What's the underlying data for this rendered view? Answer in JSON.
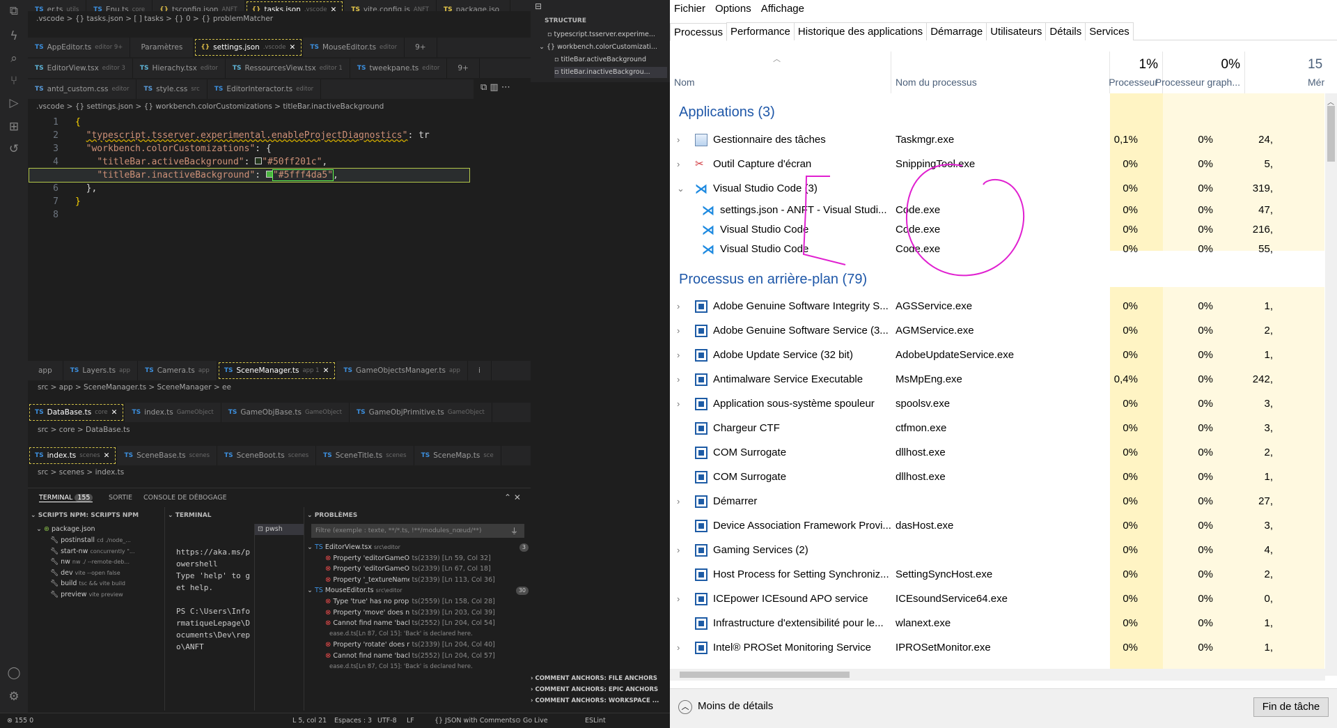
{
  "vscode": {
    "tabs_row1": [
      {
        "label": "er.ts",
        "sub": "utils"
      },
      {
        "label": "Enu.ts",
        "sub": "core"
      },
      {
        "label": "tsconfig.json",
        "sub": "ANFT"
      },
      {
        "label": "tasks.json",
        "sub": ".vscode"
      },
      {
        "label": "vite.config.js",
        "sub": "ANFT"
      },
      {
        "label": "package.jso",
        "sub": ""
      }
    ],
    "breadcrumb_top": ".vscode > {} tasks.json > [ ] tasks > {} 0 > {} problemMatcher",
    "tabs_row2": [
      {
        "label": "AppEditor.ts",
        "sub": "editor 9+"
      },
      {
        "label": "Paramètres",
        "sub": ""
      },
      {
        "label": "settings.json",
        "sub": ".vscode"
      },
      {
        "label": "MouseEditor.ts",
        "sub": "editor"
      },
      {
        "label": "9+",
        "sub": ""
      }
    ],
    "tabs_row3": [
      {
        "label": "EditorView.tsx",
        "sub": "editor 3"
      },
      {
        "label": "Hierachy.tsx",
        "sub": "editor"
      },
      {
        "label": "RessourcesView.tsx",
        "sub": "editor 1"
      },
      {
        "label": "tweekpane.ts",
        "sub": "editor"
      },
      {
        "label": "9+",
        "sub": ""
      }
    ],
    "tabs_row4": [
      {
        "label": "antd_custom.css",
        "sub": "editor"
      },
      {
        "label": "style.css",
        "sub": "src"
      },
      {
        "label": "EditorInteractor.ts",
        "sub": "editor"
      }
    ],
    "breadcrumb_editor": ".vscode > {} settings.json > {} workbench.colorCustomizations > titleBar.inactiveBackground",
    "code_lines": [
      "1",
      "2",
      "3",
      "4",
      "5",
      "6",
      "7",
      "8"
    ],
    "code": {
      "l2_key": "\"typescript.tsserver.experimental.enableProjectDiagnostics\"",
      "l2_rest": ": tr",
      "l3_key": "\"workbench.colorCustomizations\"",
      "l3_rest": ": {",
      "l4_key": "\"titleBar.activeBackground\"",
      "l4_val": "\"#50ff201c\"",
      "l5_key": "\"titleBar.inactiveBackground\"",
      "l5_val": "\"#5fff4da5\"",
      "l6": "},",
      "l7": "}"
    },
    "structure_title": "STRUCTURE",
    "structure_items": [
      "typescript.tsserver.experime...",
      "workbench.colorCustomizati...",
      "titleBar.activeBackground",
      "titleBar.inactiveBackgrou..."
    ],
    "tabs_scene": [
      {
        "label": "app",
        "sub": ""
      },
      {
        "label": "Layers.ts",
        "sub": "app"
      },
      {
        "label": "Camera.ts",
        "sub": "app"
      },
      {
        "label": "SceneManager.ts",
        "sub": "app 1"
      },
      {
        "label": "GameObjectsManager.ts",
        "sub": "app"
      },
      {
        "label": "i",
        "sub": ""
      }
    ],
    "breadcrumb_scene": "src > app > SceneManager.ts > SceneManager > ee",
    "tabs_db": [
      {
        "label": "DataBase.ts",
        "sub": "core"
      },
      {
        "label": "index.ts",
        "sub": "GameObject"
      },
      {
        "label": "GameObjBase.ts",
        "sub": "GameObject"
      },
      {
        "label": "GameObjPrimitive.ts",
        "sub": "GameObject"
      }
    ],
    "breadcrumb_db": "src > core > DataBase.ts",
    "tabs_idx": [
      {
        "label": "index.ts",
        "sub": "scenes"
      },
      {
        "label": "SceneBase.ts",
        "sub": "scenes"
      },
      {
        "label": "SceneBoot.ts",
        "sub": "scenes"
      },
      {
        "label": "SceneTitle.ts",
        "sub": "scenes"
      },
      {
        "label": "SceneMap.ts",
        "sub": "sce"
      }
    ],
    "breadcrumb_idx": "src > scenes > index.ts",
    "panel_tabs": [
      {
        "label": "TERMINAL",
        "badge": "155"
      },
      {
        "label": "SORTIE",
        "badge": ""
      },
      {
        "label": "CONSOLE DE DÉBOGAGE",
        "badge": ""
      }
    ],
    "npm_title": "SCRIPTS NPM: SCRIPTS NPM",
    "npm_package": "package.json",
    "npm_scripts": [
      {
        "name": "postinstall",
        "cmd": "cd ./node_..."
      },
      {
        "name": "start-nw",
        "cmd": "concurrently \"..."
      },
      {
        "name": "nw",
        "cmd": "nw ./ --remote-deb..."
      },
      {
        "name": "dev",
        "cmd": "vite --open false"
      },
      {
        "name": "build",
        "cmd": "tsc && vite build"
      },
      {
        "name": "preview",
        "cmd": "vite preview"
      }
    ],
    "terminal_title": "TERMINAL",
    "terminal_text": "https://aka.ms/powershell\nType 'help' to get help.\n\nPS C:\\Users\\InformatiqueLepage\\Documents\\Dev\\repo\\ANFT",
    "shell": "pwsh",
    "problems_title": "PROBLÈMES",
    "problems_filter": "Filtre (exemple : texte, **/*.ts, !**/modules_nœud/**)",
    "problems": [
      {
        "type": "file",
        "label": "EditorView.tsx",
        "path": "src\\editor",
        "count": "3"
      },
      {
        "type": "err",
        "label": "Property 'editorGameObj...",
        "loc": "ts(2339) [Ln 59, Col 32]"
      },
      {
        "type": "err",
        "label": "Property 'editorGameObj...",
        "loc": "ts(2339) [Ln 67, Col 18]"
      },
      {
        "type": "err",
        "label": "Property '_textureName...",
        "loc": "ts(2339) [Ln 113, Col 36]"
      },
      {
        "type": "file",
        "label": "MouseEditor.ts",
        "path": "src\\editor",
        "count": "30"
      },
      {
        "type": "err",
        "label": "Type 'true' has no prop...",
        "loc": "ts(2559) [Ln 158, Col 28]"
      },
      {
        "type": "err",
        "label": "Property 'move' does n...",
        "loc": "ts(2339) [Ln 203, Col 39]"
      },
      {
        "type": "err",
        "label": "Cannot find name 'back...",
        "loc": "ts(2552) [Ln 204, Col 54]"
      },
      {
        "type": "info",
        "label": "ease.d.ts[Ln 87, Col 15]: 'Back' is declared here.",
        "loc": ""
      },
      {
        "type": "err",
        "label": "Property 'rotate' does n...",
        "loc": "ts(2339) [Ln 204, Col 40]"
      },
      {
        "type": "err",
        "label": "Cannot find name 'back...",
        "loc": "ts(2552) [Ln 204, Col 57]"
      },
      {
        "type": "info",
        "label": "ease.d.ts[Ln 87, Col 15]: 'Back' is declared here.",
        "loc": ""
      }
    ],
    "anchors": [
      "COMMENT ANCHORS: FILE ANCHORS",
      "COMMENT ANCHORS: EPIC ANCHORS",
      "COMMENT ANCHORS: WORKSPACE ..."
    ],
    "status": {
      "left": "155  0",
      "pos": "L 5, col 21",
      "spaces": "Espaces : 3",
      "enc": "UTF-8",
      "eol": "LF",
      "lang": "{} JSON with Comments",
      "live": "Go Live",
      "eslint": "ESLint"
    }
  },
  "taskmanager": {
    "menu": [
      "Fichier",
      "Options",
      "Affichage"
    ],
    "tabs": [
      "Processus",
      "Performance",
      "Historique des applications",
      "Démarrage",
      "Utilisateurs",
      "Détails",
      "Services"
    ],
    "columns": {
      "name": "Nom",
      "process": "Nom du processus",
      "cpu_pct": "1%",
      "cpu": "Processeur",
      "gpu_pct": "0%",
      "gpu": "Processeur graph...",
      "mem_pct": "15",
      "mem": "Mémo"
    },
    "group_apps": "Applications (3)",
    "group_bg": "Processus en arrière-plan (79)",
    "apps": [
      {
        "name": "Gestionnaire des tâches",
        "proc": "Taskmgr.exe",
        "cpu": "0,1%",
        "gpu": "0%",
        "mem": "24,",
        "icon": "taskmgr-icon",
        "exp": "›"
      },
      {
        "name": "Outil Capture d'écran",
        "proc": "SnippingTool.exe",
        "cpu": "0%",
        "gpu": "0%",
        "mem": "5,",
        "icon": "snipping-icon",
        "exp": "›"
      },
      {
        "name": "Visual Studio Code (3)",
        "proc": "",
        "cpu": "0%",
        "gpu": "0%",
        "mem": "319,",
        "icon": "vscode-icon",
        "exp": "⌄"
      },
      {
        "name": "settings.json - ANFT - Visual Studi...",
        "proc": "Code.exe",
        "cpu": "0%",
        "gpu": "0%",
        "mem": "47,",
        "icon": "vscode-icon",
        "exp": ""
      },
      {
        "name": "Visual Studio Code",
        "proc": "Code.exe",
        "cpu": "0%",
        "gpu": "0%",
        "mem": "216,",
        "icon": "vscode-icon",
        "exp": ""
      },
      {
        "name": "Visual Studio Code",
        "proc": "Code.exe",
        "cpu": "0%",
        "gpu": "0%",
        "mem": "55,",
        "icon": "vscode-icon",
        "exp": ""
      }
    ],
    "background": [
      {
        "name": "Adobe Genuine Software Integrity S...",
        "proc": "AGSService.exe",
        "cpu": "0%",
        "gpu": "0%",
        "mem": "1,",
        "exp": "›"
      },
      {
        "name": "Adobe Genuine Software Service (3...",
        "proc": "AGMService.exe",
        "cpu": "0%",
        "gpu": "0%",
        "mem": "2,",
        "exp": "›"
      },
      {
        "name": "Adobe Update Service (32 bit)",
        "proc": "AdobeUpdateService.exe",
        "cpu": "0%",
        "gpu": "0%",
        "mem": "1,",
        "exp": "›"
      },
      {
        "name": "Antimalware Service Executable",
        "proc": "MsMpEng.exe",
        "cpu": "0,4%",
        "gpu": "0%",
        "mem": "242,",
        "exp": "›"
      },
      {
        "name": "Application sous-système spouleur",
        "proc": "spoolsv.exe",
        "cpu": "0%",
        "gpu": "0%",
        "mem": "3,",
        "exp": "›"
      },
      {
        "name": "Chargeur CTF",
        "proc": "ctfmon.exe",
        "cpu": "0%",
        "gpu": "0%",
        "mem": "3,",
        "exp": ""
      },
      {
        "name": "COM Surrogate",
        "proc": "dllhost.exe",
        "cpu": "0%",
        "gpu": "0%",
        "mem": "2,",
        "exp": ""
      },
      {
        "name": "COM Surrogate",
        "proc": "dllhost.exe",
        "cpu": "0%",
        "gpu": "0%",
        "mem": "1,",
        "exp": ""
      },
      {
        "name": "Démarrer",
        "proc": "",
        "cpu": "0%",
        "gpu": "0%",
        "mem": "27,",
        "exp": "›"
      },
      {
        "name": "Device Association Framework Provi...",
        "proc": "dasHost.exe",
        "cpu": "0%",
        "gpu": "0%",
        "mem": "3,",
        "exp": ""
      },
      {
        "name": "Gaming Services (2)",
        "proc": "",
        "cpu": "0%",
        "gpu": "0%",
        "mem": "4,",
        "exp": "›"
      },
      {
        "name": "Host Process for Setting Synchroniz...",
        "proc": "SettingSyncHost.exe",
        "cpu": "0%",
        "gpu": "0%",
        "mem": "2,",
        "exp": ""
      },
      {
        "name": "ICEpower ICEsound APO service",
        "proc": "ICEsoundService64.exe",
        "cpu": "0%",
        "gpu": "0%",
        "mem": "0,",
        "exp": "›"
      },
      {
        "name": "Infrastructure d'extensibilité pour le...",
        "proc": "wlanext.exe",
        "cpu": "0%",
        "gpu": "0%",
        "mem": "1,",
        "exp": ""
      },
      {
        "name": "Intel® PROSet Monitoring Service",
        "proc": "IPROSetMonitor.exe",
        "cpu": "0%",
        "gpu": "0%",
        "mem": "1,",
        "exp": "›"
      }
    ],
    "footer_less": "Moins de détails",
    "footer_end": "Fin de tâche",
    "annotation_color": "#e020d0"
  }
}
